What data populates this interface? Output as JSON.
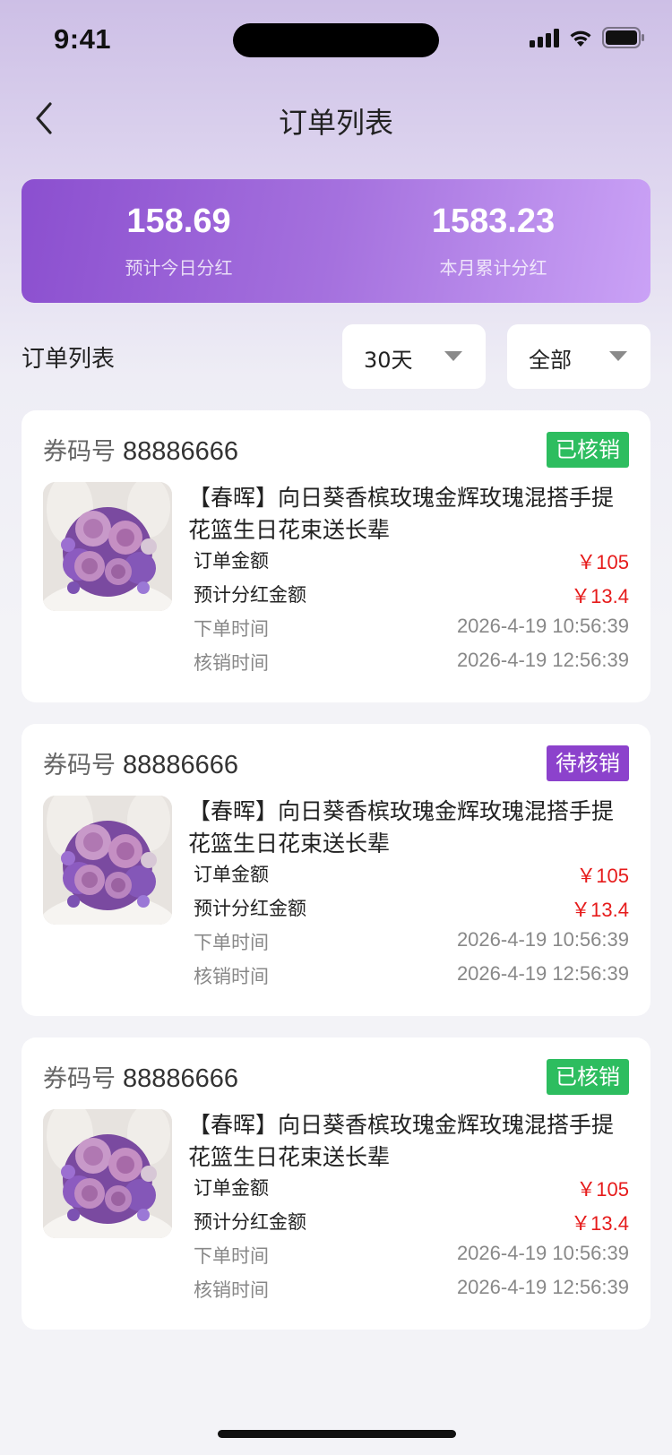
{
  "status_bar": {
    "time": "9:41"
  },
  "header": {
    "title": "订单列表",
    "back_icon": "chevron-left-icon"
  },
  "summary": {
    "today": {
      "value": "158.69",
      "label": "预计今日分红"
    },
    "month": {
      "value": "1583.23",
      "label": "本月累计分红"
    }
  },
  "filters": {
    "section_title": "订单列表",
    "days": {
      "value": "30天",
      "icon": "caret-down-icon"
    },
    "status": {
      "value": "全部",
      "icon": "caret-down-icon"
    }
  },
  "labels": {
    "coupon": "券码号",
    "order_amount": "订单金额",
    "bonus_amount": "预计分红金额",
    "order_time": "下单时间",
    "verify_time": "核销时间"
  },
  "colors": {
    "accent": "#8b4fcf",
    "verified": "#2dbd5f",
    "pending": "#8c42cc",
    "price": "#e61b1b"
  },
  "orders": [
    {
      "coupon_no": "88886666",
      "status": "已核销",
      "status_type": "verified",
      "product_name": "【春晖】向日葵香槟玫瑰金辉玫瑰混搭手提花篮生日花束送长辈",
      "amount": "￥105",
      "bonus": "￥13.4",
      "order_time": "2026-4-19  10:56:39",
      "verify_time": "2026-4-19  12:56:39"
    },
    {
      "coupon_no": "88886666",
      "status": "待核销",
      "status_type": "pending",
      "product_name": "【春晖】向日葵香槟玫瑰金辉玫瑰混搭手提花篮生日花束送长辈",
      "amount": "￥105",
      "bonus": "￥13.4",
      "order_time": "2026-4-19  10:56:39",
      "verify_time": "2026-4-19  12:56:39"
    },
    {
      "coupon_no": "88886666",
      "status": "已核销",
      "status_type": "verified",
      "product_name": "【春晖】向日葵香槟玫瑰金辉玫瑰混搭手提花篮生日花束送长辈",
      "amount": "￥105",
      "bonus": "￥13.4",
      "order_time": "2026-4-19  10:56:39",
      "verify_time": "2026-4-19  12:56:39"
    }
  ]
}
